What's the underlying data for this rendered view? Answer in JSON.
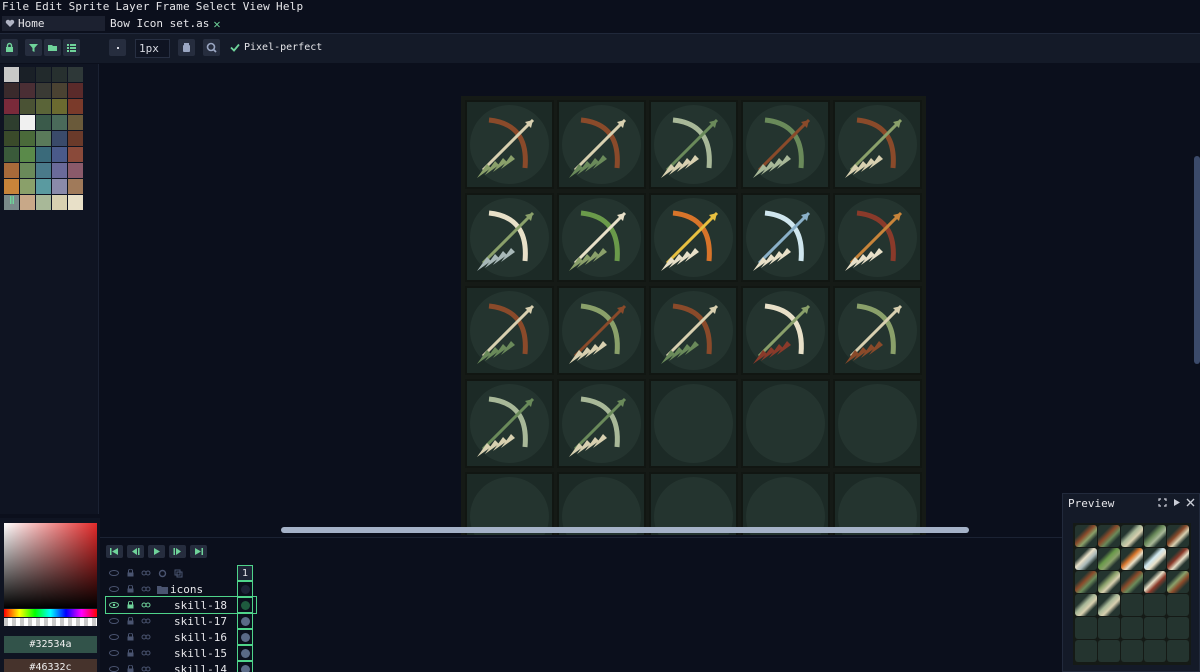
{
  "menu": [
    "File",
    "Edit",
    "Sprite",
    "Layer",
    "Frame",
    "Select",
    "View",
    "Help"
  ],
  "tabs": {
    "home": "Home",
    "file": "Bow Icon set.as"
  },
  "toolbar": {
    "brush_size": "1px",
    "pixel_perfect": "Pixel-perfect"
  },
  "palette": {
    "swatches": [
      "#c8c8c8",
      "#1a2027",
      "#222a2c",
      "#27302f",
      "#2e3838",
      "#3a2a2c",
      "#4a2e34",
      "#3a3a34",
      "#4a4232",
      "#5a2a2a",
      "#7a2a3a",
      "#4a5234",
      "#5a6438",
      "#6b6a30",
      "#7a3a2a",
      "#2e3e2e",
      "#f0f0f0",
      "#3a5a4a",
      "#4a6a5a",
      "#6a5a3a",
      "#3a4a2a",
      "#4a6a3a",
      "#5a7a5a",
      "#3a4a6a",
      "#6a3a2a",
      "#3a5a3a",
      "#5a8a4a",
      "#3a6a7a",
      "#4a5a8a",
      "#8a4a3a",
      "#a86a3a",
      "#6a8a5a",
      "#4a7a8a",
      "#6a6a9a",
      "#8a5a6a",
      "#c8843a",
      "#8aa06a",
      "#5a9aa0",
      "#8a8aaa",
      "#a07a5a",
      "#7a8a8a",
      "#c8a888",
      "#a8b898",
      "#d8d0b0",
      "#e8e0c8"
    ]
  },
  "color_picker": {
    "fg_hex": "#32534a",
    "bg_hex": "#46332c"
  },
  "layers": [
    {
      "name": "icons",
      "type": "group"
    },
    {
      "name": "skill-18",
      "selected": true
    },
    {
      "name": "skill-17"
    },
    {
      "name": "skill-16"
    },
    {
      "name": "skill-15"
    },
    {
      "name": "skill-14"
    }
  ],
  "timeline": {
    "frame_number": "1"
  },
  "preview": {
    "title": "Preview"
  },
  "colors": {
    "accent": "#4fd48a",
    "canvas_bg": "#0b0f1c",
    "icon_disc": "#24342f"
  }
}
